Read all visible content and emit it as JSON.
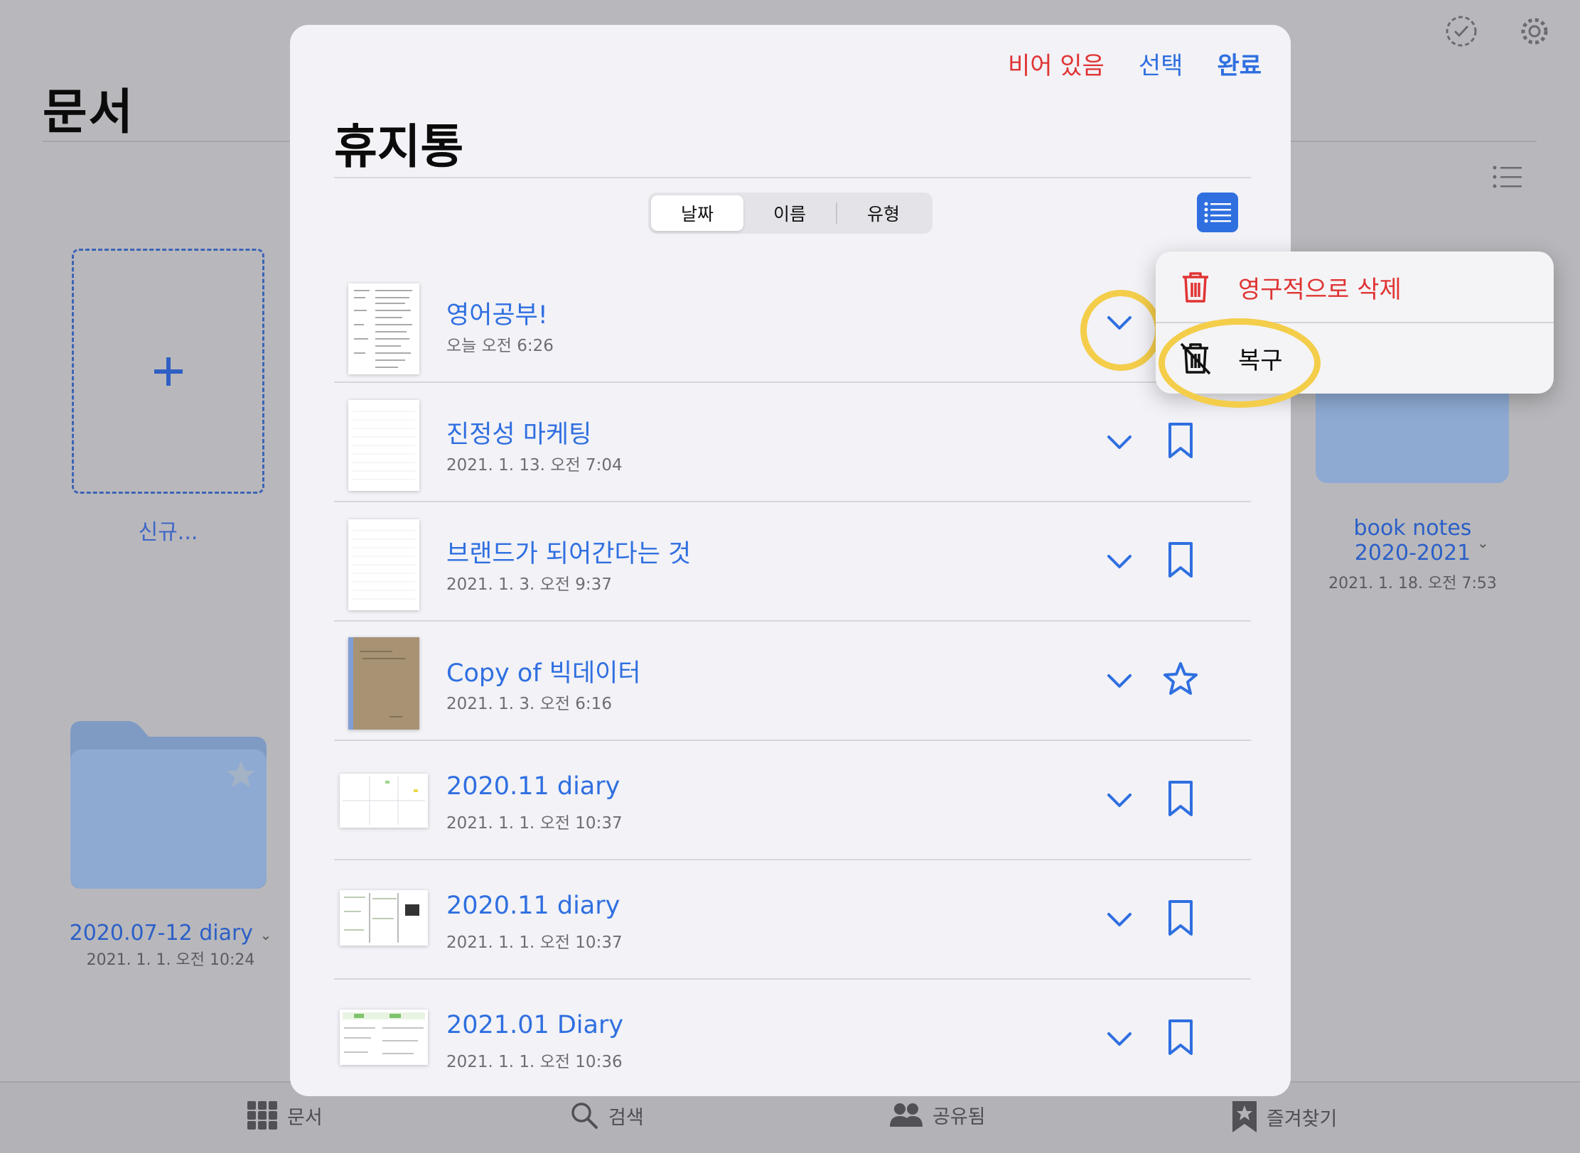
{
  "background": {
    "title": "문서",
    "new_label": "신규...",
    "folders": [
      {
        "name": "2020.07-12 diary",
        "date": "2021. 1. 1. 오전 10:24"
      },
      {
        "name_line1": "book notes",
        "name_line2": "2020-2021",
        "date": "2021. 1. 18. 오전 7:53"
      }
    ],
    "tabbar": [
      {
        "label": "문서",
        "icon": "grid-icon"
      },
      {
        "label": "검색",
        "icon": "search-icon"
      },
      {
        "label": "공유됨",
        "icon": "people-icon"
      },
      {
        "label": "즐겨찾기",
        "icon": "bookmark-star-icon"
      }
    ]
  },
  "modal": {
    "title": "휴지통",
    "actions": {
      "empty": "비어 있음",
      "select": "선택",
      "done": "완료"
    },
    "sort": {
      "options": [
        "날짜",
        "이름",
        "유형"
      ],
      "selected": "날짜"
    },
    "items": [
      {
        "title": "영어공부!",
        "date": "오늘 오전 6:26",
        "mark": "none"
      },
      {
        "title": "진정성 마케팅",
        "date": "2021. 1. 13. 오전 7:04",
        "mark": "bookmark"
      },
      {
        "title": "브랜드가 되어간다는 것",
        "date": "2021. 1. 3. 오전 9:37",
        "mark": "bookmark"
      },
      {
        "title": "Copy of 빅데이터",
        "date": "2021. 1. 3. 오전 6:16",
        "mark": "star"
      },
      {
        "title": "2020.11 diary",
        "date": "2021. 1. 1. 오전 10:37",
        "mark": "bookmark"
      },
      {
        "title": "2020.11 diary",
        "date": "2021. 1. 1. 오전 10:37",
        "mark": "bookmark"
      },
      {
        "title": "2021.01 Diary",
        "date": "2021. 1. 1. 오전 10:36",
        "mark": "bookmark"
      }
    ]
  },
  "context_menu": {
    "delete_label": "영구적으로 삭제",
    "restore_label": "복구"
  },
  "colors": {
    "accent": "#2f6fe0",
    "destructive": "#e03434",
    "highlight": "#f4cd4a"
  }
}
